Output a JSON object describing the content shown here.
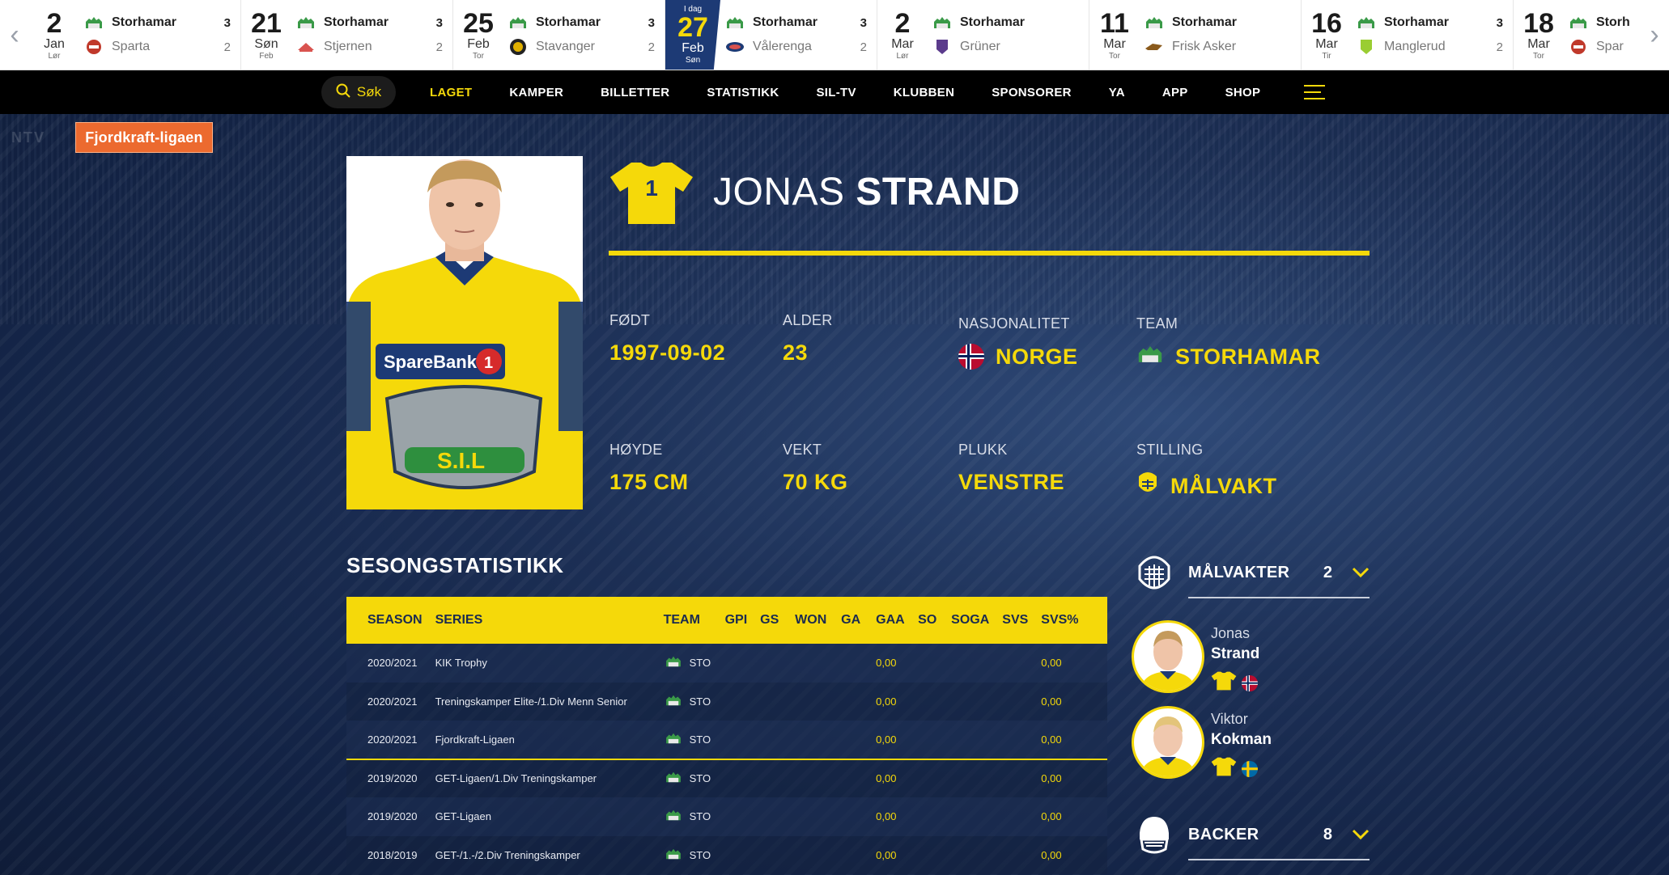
{
  "matches": [
    {
      "day": "2",
      "mon": "Jan",
      "dow": "Lør",
      "home": "Storhamar",
      "home_score": "3",
      "away": "Sparta",
      "away_score": "2",
      "away_color": "#c0392b"
    },
    {
      "day": "21",
      "mon": "Søn",
      "dow": "Feb",
      "home": "Storhamar",
      "home_score": "3",
      "away": "Stjernen",
      "away_score": "2",
      "away_color": "#d9534f"
    },
    {
      "day": "25",
      "mon": "Feb",
      "dow": "Tor",
      "home": "Storhamar",
      "home_score": "3",
      "away": "Stavanger",
      "away_score": "2",
      "away_color": "#222222"
    },
    {
      "tag": "I dag",
      "day": "27",
      "mon": "Feb",
      "dow": "Søn",
      "home": "Storhamar",
      "home_score": "3",
      "away": "Vålerenga",
      "away_score": "2",
      "away_color": "#1d3a75",
      "today": true
    },
    {
      "day": "2",
      "mon": "Mar",
      "dow": "Lør",
      "home": "Storhamar",
      "home_score": "",
      "away": "Grüner",
      "away_score": "",
      "away_color": "#5b3b8c"
    },
    {
      "day": "11",
      "mon": "Mar",
      "dow": "Tor",
      "home": "Storhamar",
      "home_score": "",
      "away": "Frisk Asker",
      "away_score": "",
      "away_color": "#8a5a1c"
    },
    {
      "day": "16",
      "mon": "Mar",
      "dow": "Tir",
      "home": "Storhamar",
      "home_score": "3",
      "away": "Manglerud",
      "away_score": "2",
      "away_color": "#9acd32"
    },
    {
      "day": "18",
      "mon": "Mar",
      "dow": "Tor",
      "home": "Storh",
      "home_score": "",
      "away": "Spar",
      "away_score": "",
      "away_color": "#c0392b"
    }
  ],
  "nav": {
    "search_label": "Søk",
    "items": [
      "LAGET",
      "KAMPER",
      "BILLETTER",
      "STATISTIKK",
      "SIL-TV",
      "KLUBBEN",
      "SPONSORER",
      "YA",
      "APP",
      "SHOP"
    ]
  },
  "league_badge": "Fjordkraft-ligaen",
  "player": {
    "number": "1",
    "first_name": "JONAS",
    "last_name": "STRAND",
    "facts": {
      "born_label": "FØDT",
      "born": "1997-09-02",
      "age_label": "ALDER",
      "age": "23",
      "nationality_label": "NASJONALITET",
      "nationality": "NORGE",
      "team_label": "TEAM",
      "team": "STORHAMAR",
      "height_label": "HØYDE",
      "height": "175 CM",
      "weight_label": "VEKT",
      "weight": "70 KG",
      "catch_label": "PLUKK",
      "catch": "VENSTRE",
      "position_label": "STILLING",
      "position": "MÅLVAKT"
    }
  },
  "stats": {
    "title": "SESONGSTATISTIKK",
    "headers": [
      "SEASON",
      "SERIES",
      "TEAM",
      "GPI",
      "GS",
      "WON",
      "GA",
      "GAA",
      "SO",
      "SOGA",
      "SVS",
      "SVS%"
    ],
    "rows": [
      {
        "season": "2020/2021",
        "series": "KIK Trophy",
        "team": "STO",
        "gaa": "0,00",
        "svs_pct": "0,00"
      },
      {
        "season": "2020/2021",
        "series": "Treningskamper Elite-/1.Div Menn Senior",
        "team": "STO",
        "gaa": "0,00",
        "svs_pct": "0,00"
      },
      {
        "season": "2020/2021",
        "series": "Fjordkraft-Ligaen",
        "team": "STO",
        "gaa": "0,00",
        "svs_pct": "0,00"
      },
      {
        "season": "2019/2020",
        "series": "GET-Ligaen/1.Div Treningskamper",
        "team": "STO",
        "gaa": "0,00",
        "svs_pct": "0,00"
      },
      {
        "season": "2019/2020",
        "series": "GET-Ligaen",
        "team": "STO",
        "gaa": "0,00",
        "svs_pct": "0,00"
      },
      {
        "season": "2018/2019",
        "series": "GET-/1.-/2.Div Treningskamper",
        "team": "STO",
        "gaa": "0,00",
        "svs_pct": "0,00"
      }
    ]
  },
  "roster": {
    "goalies": {
      "label": "MÅLVAKTER",
      "count": "2"
    },
    "players": [
      {
        "first": "Jonas",
        "last": "Strand",
        "flag": "norway-flag-icon"
      },
      {
        "first": "Viktor",
        "last": "Kokman",
        "flag": "sweden-flag-icon"
      }
    ],
    "backs": {
      "label": "BACKER",
      "count": "8"
    }
  },
  "colors": {
    "accent": "#f5d90a",
    "navy": "#1d3a75",
    "nav_bg": "#000000",
    "badge": "#ec6a2f"
  }
}
